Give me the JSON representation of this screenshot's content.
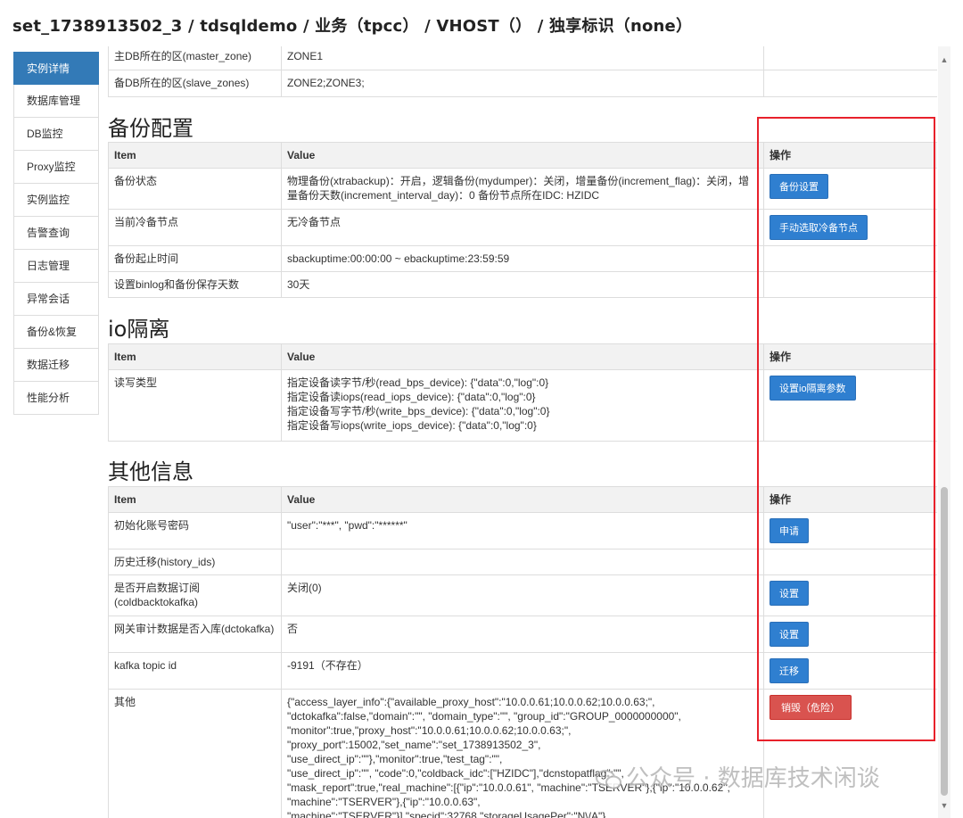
{
  "header": {
    "title": "set_1738913502_3 / tdsqldemo / 业务（tpcc） / VHOST（） / 独享标识（none）"
  },
  "sidebar": {
    "items": [
      {
        "label": "实例详情",
        "active": true
      },
      {
        "label": "数据库管理"
      },
      {
        "label": "DB监控"
      },
      {
        "label": "Proxy监控"
      },
      {
        "label": "实例监控"
      },
      {
        "label": "告警查询"
      },
      {
        "label": "日志管理"
      },
      {
        "label": "异常会话"
      },
      {
        "label": "备份&恢复"
      },
      {
        "label": "数据迁移"
      },
      {
        "label": "性能分析"
      }
    ]
  },
  "top_table": {
    "rows": [
      {
        "item": "主DB所在的区(master_zone)",
        "value": "ZONE1"
      },
      {
        "item": "备DB所在的区(slave_zones)",
        "value": "ZONE2;ZONE3;"
      }
    ]
  },
  "backup": {
    "title": "备份配置",
    "headers": {
      "item": "Item",
      "value": "Value",
      "op": "操作"
    },
    "rows": [
      {
        "item": "备份状态",
        "value": "物理备份(xtrabackup)：开启，逻辑备份(mydumper)：关闭，增量备份(increment_flag)：关闭，增量备份天数(increment_interval_day)：0  备份节点所在IDC: HZIDC",
        "button": "备份设置"
      },
      {
        "item": "当前冷备节点",
        "value": "无冷备节点",
        "button": "手动选取冷备节点"
      },
      {
        "item": "备份起止时间",
        "value": "sbackuptime:00:00:00 ~ ebackuptime:23:59:59"
      },
      {
        "item": "设置binlog和备份保存天数",
        "value": "30天"
      }
    ]
  },
  "io": {
    "title": "io隔离",
    "headers": {
      "item": "Item",
      "value": "Value",
      "op": "操作"
    },
    "rows": [
      {
        "item": "读写类型",
        "value": "指定设备读字节/秒(read_bps_device): {\"data\":0,\"log\":0}\n指定设备读iops(read_iops_device): {\"data\":0,\"log\":0}\n指定设备写字节/秒(write_bps_device): {\"data\":0,\"log\":0}\n指定设备写iops(write_iops_device): {\"data\":0,\"log\":0}",
        "button": "设置io隔离参数"
      }
    ]
  },
  "other": {
    "title": "其他信息",
    "headers": {
      "item": "Item",
      "value": "Value",
      "op": "操作"
    },
    "rows": [
      {
        "item": "初始化账号密码",
        "value": "\"user\":\"***\", \"pwd\":\"******\"",
        "button": "申请"
      },
      {
        "item": "历史迁移(history_ids)",
        "value": ""
      },
      {
        "item": "是否开启数据订阅\n(coldbacktokafka)",
        "value": "关闭(0)",
        "button": "设置"
      },
      {
        "item": "网关审计数据是否入库(dctokafka)",
        "value": "否",
        "button": "设置"
      },
      {
        "item": "kafka topic id",
        "value": "-9191（不存在）",
        "button": "迁移"
      },
      {
        "item": "其他",
        "value": "{\"access_layer_info\":{\"available_proxy_host\":\"10.0.0.61;10.0.0.62;10.0.0.63;\",\n\"dctokafka\":false,\"domain\":\"\", \"domain_type\":\"\", \"group_id\":\"GROUP_0000000000\",\n\"monitor\":true,\"proxy_host\":\"10.0.0.61;10.0.0.62;10.0.0.63;\",\n\"proxy_port\":15002,\"set_name\":\"set_1738913502_3\", \"use_direct_ip\":\"\"},\"monitor\":true,\"test_tag\":\"\",\n\"use_direct_ip\":\"\", \"code\":0,\"coldback_idc\":[\"HZIDC\"],\"dcnstopatflag\":\"\",\n\"mask_report\":true,\"real_machine\":[{\"ip\":\"10.0.0.61\", \"machine\":\"TSERVER\"},{\"ip\":\"10.0.0.62\",\n\"machine\":\"TSERVER\"},{\"ip\":\"10.0.0.63\",\n\"machine\":\"TSERVER\"}],\"specid\":32768,\"storageUsagePer\":\"N\\/A\"}",
        "button": "销毁（危险）"
      }
    ]
  },
  "watermark": {
    "text": "公众号 · 数据库技术闲谈"
  },
  "colors": {
    "accent": "#2f7fd0",
    "danger": "#d9534f",
    "highlight_box": "#e8212b",
    "sidebar_active": "#337ab7"
  }
}
